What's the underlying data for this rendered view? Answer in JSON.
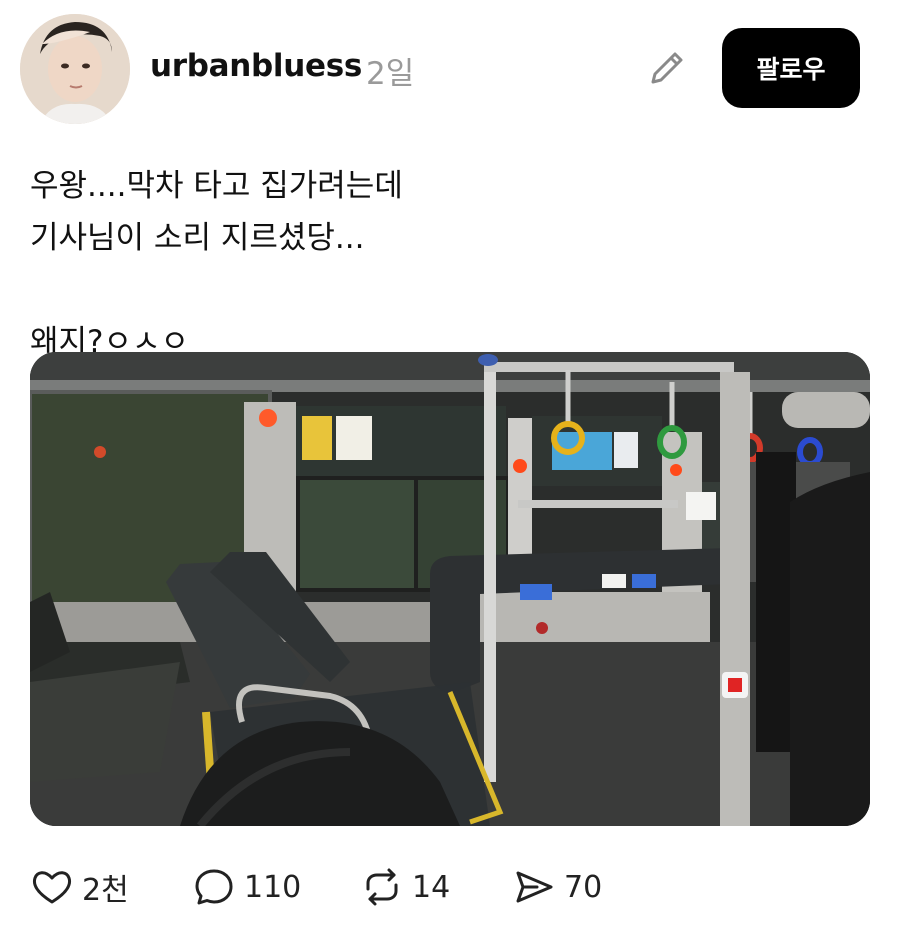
{
  "post": {
    "username": "urbanbluess",
    "timestamp": "2일",
    "follow_label": "팔로우",
    "text_lines": [
      "우왕....막차 타고 집가려는데",
      "기사님이 소리 지르셨당..."
    ],
    "text_second_paragraph": "왜지?ㅇㅅㅇ"
  },
  "actions": {
    "likes": "2천",
    "comments": "110",
    "reposts": "14",
    "shares": "70"
  },
  "icons": {
    "edit": "pencil-icon",
    "like": "heart-icon",
    "comment": "speech-bubble-icon",
    "repost": "repost-arrows-icon",
    "share": "send-icon"
  },
  "colors": {
    "follow_button_bg": "#000000",
    "timestamp": "#9a9a9a",
    "bus_handle_yellow": "#e6b21b",
    "bus_handle_green": "#2f9a3f",
    "bus_handle_red": "#d23a2a",
    "bus_handle_blue": "#2b4bd1"
  }
}
